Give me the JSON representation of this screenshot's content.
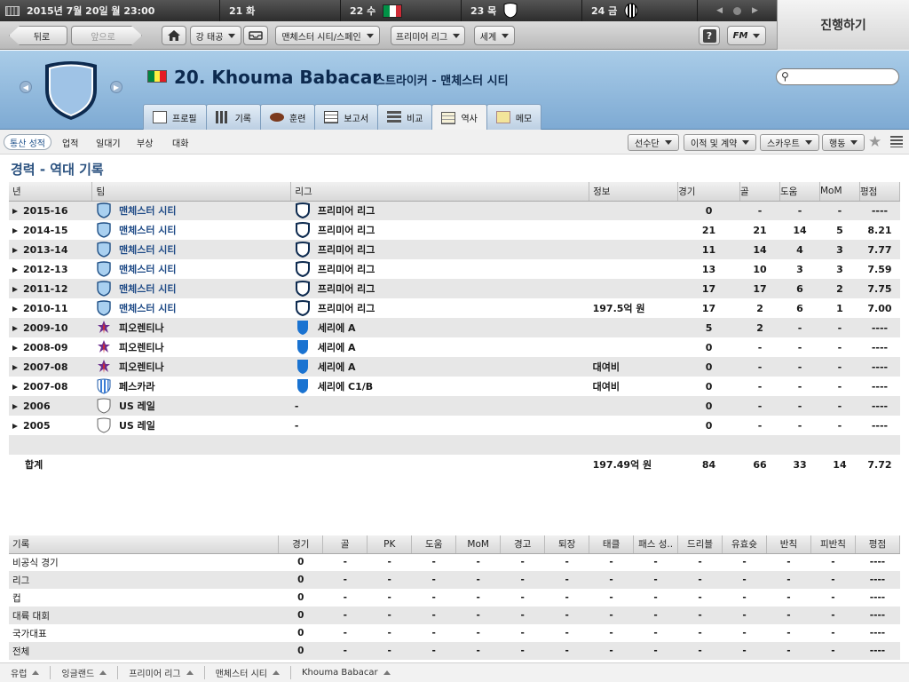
{
  "topbar": {
    "date": "2015년 7월 20일 월 23:00",
    "days": [
      {
        "label": "21 화",
        "icon": ""
      },
      {
        "label": "22 수",
        "icon": "italy-flag-icon"
      },
      {
        "label": "23 목",
        "icon": "club-shield-icon"
      },
      {
        "label": "24 금",
        "icon": "striped-badge-icon"
      }
    ]
  },
  "continue_label": "진행하기",
  "nav": {
    "back": "뒤로",
    "forward": "앞으로",
    "club_menu": "강 태공",
    "team_menu": "맨체스터 시티/스페인",
    "league_menu": "프리미어 리그",
    "world_menu": "세계",
    "fm_menu": "FM"
  },
  "player": {
    "number_name": "20. Khouma Babacar",
    "subtitle": "스트라이커 - 맨체스터 시티",
    "flag_colors": [
      "#00853f",
      "#fdef42",
      "#e31b23"
    ]
  },
  "tabs": [
    {
      "label": "프로필",
      "active": false
    },
    {
      "label": "기록",
      "active": false
    },
    {
      "label": "훈련",
      "active": false
    },
    {
      "label": "보고서",
      "active": false
    },
    {
      "label": "비교",
      "active": false
    },
    {
      "label": "역사",
      "active": true
    },
    {
      "label": "메모",
      "active": false
    }
  ],
  "subnav": {
    "links": [
      "통산 성적",
      "업적",
      "일대기",
      "부상",
      "대화"
    ],
    "buttons": [
      "선수단",
      "이적 및 계약",
      "스카우트",
      "행동"
    ]
  },
  "section_title": "경력 - 역대 기록",
  "career": {
    "headers": [
      "년",
      "팀",
      "리그",
      "정보",
      "경기",
      "골",
      "도움",
      "MoM",
      "평점"
    ],
    "rows": [
      {
        "year": "2015-16",
        "team": "맨체스터 시티",
        "team_link": true,
        "team_icon": "blue",
        "league": "프리미어 리그",
        "league_icon": "outline",
        "info": "",
        "apps": "0",
        "goals": "-",
        "assists": "-",
        "mom": "-",
        "rating": "----"
      },
      {
        "year": "2014-15",
        "team": "맨체스터 시티",
        "team_link": true,
        "team_icon": "blue",
        "league": "프리미어 리그",
        "league_icon": "outline",
        "info": "",
        "apps": "21",
        "goals": "21",
        "assists": "14",
        "mom": "5",
        "rating": "8.21"
      },
      {
        "year": "2013-14",
        "team": "맨체스터 시티",
        "team_link": true,
        "team_icon": "blue",
        "league": "프리미어 리그",
        "league_icon": "outline",
        "info": "",
        "apps": "11",
        "goals": "14",
        "assists": "4",
        "mom": "3",
        "rating": "7.77"
      },
      {
        "year": "2012-13",
        "team": "맨체스터 시티",
        "team_link": true,
        "team_icon": "blue",
        "league": "프리미어 리그",
        "league_icon": "outline",
        "info": "",
        "apps": "13",
        "goals": "10",
        "assists": "3",
        "mom": "3",
        "rating": "7.59"
      },
      {
        "year": "2011-12",
        "team": "맨체스터 시티",
        "team_link": true,
        "team_icon": "blue",
        "league": "프리미어 리그",
        "league_icon": "outline",
        "info": "",
        "apps": "17",
        "goals": "17",
        "assists": "6",
        "mom": "2",
        "rating": "7.75"
      },
      {
        "year": "2010-11",
        "team": "맨체스터 시티",
        "team_link": true,
        "team_icon": "blue",
        "league": "프리미어 리그",
        "league_icon": "outline",
        "info": "197.5억 원",
        "apps": "17",
        "goals": "2",
        "assists": "6",
        "mom": "1",
        "rating": "7.00"
      },
      {
        "year": "2009-10",
        "team": "피오렌티나",
        "team_link": false,
        "team_icon": "fiorentina",
        "league": "세리에 A",
        "league_icon": "seriea",
        "info": "",
        "apps": "5",
        "goals": "2",
        "assists": "-",
        "mom": "-",
        "rating": "----"
      },
      {
        "year": "2008-09",
        "team": "피오렌티나",
        "team_link": false,
        "team_icon": "fiorentina",
        "league": "세리에 A",
        "league_icon": "seriea",
        "info": "",
        "apps": "0",
        "goals": "-",
        "assists": "-",
        "mom": "-",
        "rating": "----"
      },
      {
        "year": "2007-08",
        "team": "피오렌티나",
        "team_link": false,
        "team_icon": "fiorentina",
        "league": "세리에 A",
        "league_icon": "seriea",
        "info": "대여비",
        "apps": "0",
        "goals": "-",
        "assists": "-",
        "mom": "-",
        "rating": "----"
      },
      {
        "year": "2007-08",
        "team": "페스카라",
        "team_link": false,
        "team_icon": "pescara",
        "league": "세리에 C1/B",
        "league_icon": "seriea",
        "info": "대여비",
        "apps": "0",
        "goals": "-",
        "assists": "-",
        "mom": "-",
        "rating": "----"
      },
      {
        "year": "2006",
        "team": "US 레일",
        "team_link": false,
        "team_icon": "plain",
        "league": "-",
        "league_icon": "",
        "info": "",
        "apps": "0",
        "goals": "-",
        "assists": "-",
        "mom": "-",
        "rating": "----"
      },
      {
        "year": "2005",
        "team": "US 레일",
        "team_link": false,
        "team_icon": "plain",
        "league": "-",
        "league_icon": "",
        "info": "",
        "apps": "0",
        "goals": "-",
        "assists": "-",
        "mom": "-",
        "rating": "----"
      }
    ],
    "total": {
      "label": "합계",
      "info": "197.49억 원",
      "apps": "84",
      "goals": "66",
      "assists": "33",
      "mom": "14",
      "rating": "7.72"
    }
  },
  "records": {
    "headers": [
      "기록",
      "경기",
      "골",
      "PK",
      "도움",
      "MoM",
      "경고",
      "퇴장",
      "태클",
      "패스 성..",
      "드리블",
      "유효슛",
      "반칙",
      "피반칙",
      "평점"
    ],
    "rows": [
      [
        "비공식 경기",
        "0",
        "-",
        "-",
        "-",
        "-",
        "-",
        "-",
        "-",
        "-",
        "-",
        "-",
        "-",
        "-",
        "----"
      ],
      [
        "리그",
        "0",
        "-",
        "-",
        "-",
        "-",
        "-",
        "-",
        "-",
        "-",
        "-",
        "-",
        "-",
        "-",
        "----"
      ],
      [
        "컵",
        "0",
        "-",
        "-",
        "-",
        "-",
        "-",
        "-",
        "-",
        "-",
        "-",
        "-",
        "-",
        "-",
        "----"
      ],
      [
        "대륙 대회",
        "0",
        "-",
        "-",
        "-",
        "-",
        "-",
        "-",
        "-",
        "-",
        "-",
        "-",
        "-",
        "-",
        "----"
      ],
      [
        "국가대표",
        "0",
        "-",
        "-",
        "-",
        "-",
        "-",
        "-",
        "-",
        "-",
        "-",
        "-",
        "-",
        "-",
        "----"
      ],
      [
        "전체",
        "0",
        "-",
        "-",
        "-",
        "-",
        "-",
        "-",
        "-",
        "-",
        "-",
        "-",
        "-",
        "-",
        "----"
      ]
    ]
  },
  "breadcrumbs": [
    "유럽",
    "잉글랜드",
    "프리미어 리그",
    "맨체스터 시티",
    "Khouma Babacar"
  ]
}
